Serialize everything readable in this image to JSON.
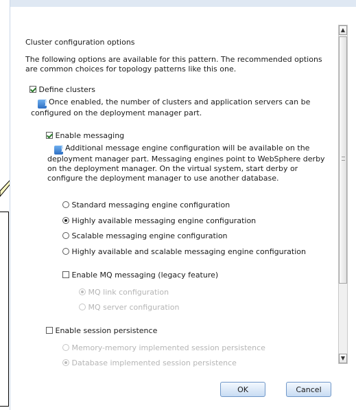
{
  "section_title": "Cluster configuration options",
  "intro_text": "The following options are available for this pattern. The recommended options are common choices for topology patterns like this one.",
  "define_clusters": {
    "label": "Define clusters",
    "checked": true,
    "info": "Once enabled, the number of clusters and application servers can be configured on the deployment manager part."
  },
  "enable_messaging": {
    "label": "Enable messaging",
    "checked": true,
    "info": "Additional message engine configuration will be available on the deployment manager part. Messaging engines point to WebSphere derby on the deployment manager. On the virtual system, start derby or configure the deployment manager to use another database.",
    "options": [
      {
        "label": "Standard messaging engine configuration",
        "selected": false
      },
      {
        "label": "Highly available messaging engine configuration",
        "selected": true
      },
      {
        "label": "Scalable messaging engine configuration",
        "selected": false
      },
      {
        "label": "Highly available and scalable messaging engine configuration",
        "selected": false
      }
    ]
  },
  "enable_mq": {
    "label": "Enable MQ messaging (legacy feature)",
    "checked": false,
    "options": [
      {
        "label": "MQ link configuration",
        "selected": true
      },
      {
        "label": "MQ server configuration",
        "selected": false
      }
    ]
  },
  "session_persistence": {
    "label": "Enable session persistence",
    "checked": false,
    "options": [
      {
        "label": "Memory-memory implemented session persistence",
        "selected": false
      },
      {
        "label": "Database implemented session persistence",
        "selected": true
      }
    ]
  },
  "buttons": {
    "ok": "OK",
    "cancel": "Cancel"
  },
  "colors": {
    "accent": "#2e6fc2",
    "button_border": "#6e96c8",
    "disabled_text": "#b5b5b5"
  }
}
